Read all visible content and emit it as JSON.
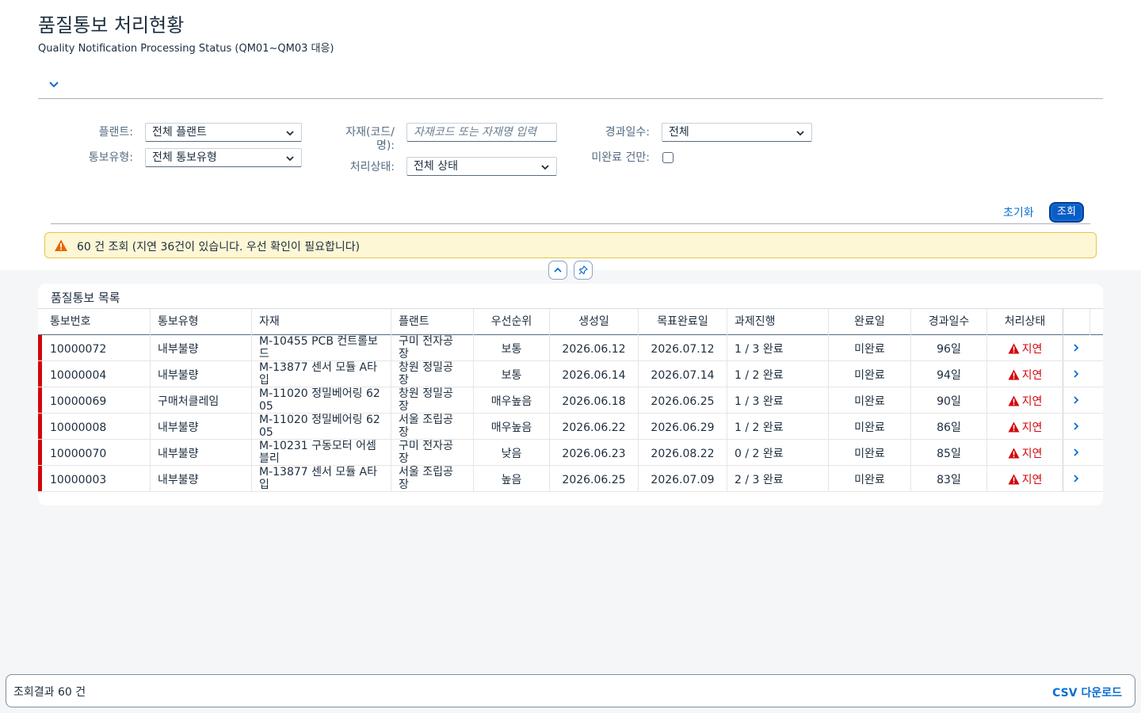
{
  "header": {
    "title": "품질통보 처리현황",
    "subtitle": "Quality Notification Processing Status (QM01~QM03 대응)"
  },
  "filters": {
    "plant": {
      "label": "플랜트:",
      "value": "전체 플랜트"
    },
    "notif_type": {
      "label": "통보유형:",
      "value": "전체 통보유형"
    },
    "material": {
      "label_line1": "자재(코드/",
      "label_line2": "명):",
      "placeholder": "자재코드 또는 자재명 입력",
      "value": ""
    },
    "status": {
      "label": "처리상태:",
      "value": "전체 상태"
    },
    "elapsed": {
      "label": "경과일수:",
      "value": "전체"
    },
    "incomplete": {
      "label": "미완료 건만:",
      "checked": false
    }
  },
  "actions": {
    "reset_label": "초기화",
    "search_label": "조회"
  },
  "message": {
    "type": "warning",
    "text": "60 건 조회 (지연 36건이 있습니다. 우선 확인이 필요합니다)"
  },
  "table": {
    "title": "품질통보 목록",
    "columns": [
      "통보번호",
      "통보유형",
      "자재",
      "플랜트",
      "우선순위",
      "생성일",
      "목표완료일",
      "과제진행",
      "완료일",
      "경과일수",
      "처리상태"
    ],
    "rows": [
      {
        "no": "10000072",
        "type": "내부불량",
        "material": "M-10455 PCB 컨트롤보드",
        "plant": "구미 전자공장",
        "priority": "보통",
        "created": "2026.06.12",
        "target": "2026.07.12",
        "progress": "1 / 3 완료",
        "done": "미완료",
        "elapsed": "96일",
        "status": "지연"
      },
      {
        "no": "10000004",
        "type": "내부불량",
        "material": "M-13877 센서 모듈 A타입",
        "plant": "창원 정밀공장",
        "priority": "보통",
        "created": "2026.06.14",
        "target": "2026.07.14",
        "progress": "1 / 2 완료",
        "done": "미완료",
        "elapsed": "94일",
        "status": "지연"
      },
      {
        "no": "10000069",
        "type": "구매처클레임",
        "material": "M-11020 정밀베어링 6205",
        "plant": "창원 정밀공장",
        "priority": "매우높음",
        "created": "2026.06.18",
        "target": "2026.06.25",
        "progress": "1 / 3 완료",
        "done": "미완료",
        "elapsed": "90일",
        "status": "지연"
      },
      {
        "no": "10000008",
        "type": "내부불량",
        "material": "M-11020 정밀베어링 6205",
        "plant": "서울 조립공장",
        "priority": "매우높음",
        "created": "2026.06.22",
        "target": "2026.06.29",
        "progress": "1 / 2 완료",
        "done": "미완료",
        "elapsed": "86일",
        "status": "지연"
      },
      {
        "no": "10000070",
        "type": "내부불량",
        "material": "M-10231 구동모터 어셈블리",
        "plant": "구미 전자공장",
        "priority": "낮음",
        "created": "2026.06.23",
        "target": "2026.08.22",
        "progress": "0 / 2 완료",
        "done": "미완료",
        "elapsed": "85일",
        "status": "지연"
      },
      {
        "no": "10000003",
        "type": "내부불량",
        "material": "M-13877 센서 모듈 A타입",
        "plant": "서울 조립공장",
        "priority": "높음",
        "created": "2026.06.25",
        "target": "2026.07.09",
        "progress": "2 / 3 완료",
        "done": "미완료",
        "elapsed": "83일",
        "status": "지연"
      }
    ]
  },
  "footer": {
    "count_text": "조회결과 60 건",
    "csv_label": "CSV 다운로드"
  },
  "colors": {
    "accent": "#0a6ed1",
    "critical": "#d3060c",
    "warning_bg": "#fef7d5",
    "warning_icon": "#e76500"
  },
  "icons": {
    "expand": "chevron-down-icon",
    "warning": "warning-icon",
    "collapse": "chevron-up-icon",
    "pin": "pin-icon",
    "row_nav": "chevron-right-icon",
    "status": "alert-triangle-icon"
  }
}
